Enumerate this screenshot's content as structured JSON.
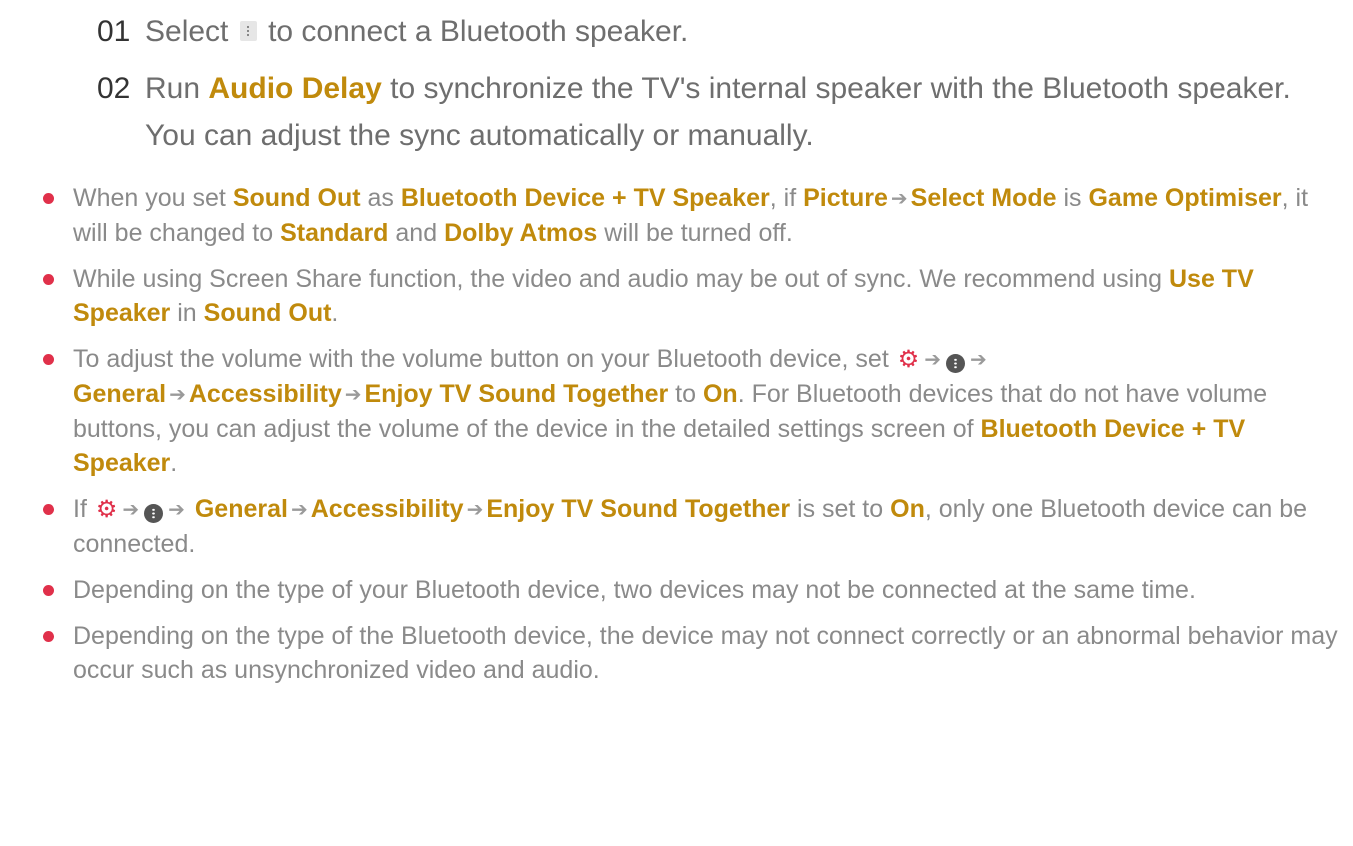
{
  "steps": [
    {
      "num": "01",
      "pre": "Select",
      "post": "to connect a Bluetooth speaker."
    },
    {
      "num": "02",
      "pre": "Run",
      "kw": "Audio Delay",
      "post": "to synchronize the TV's internal speaker with the Bluetooth speaker. You can adjust the sync automatically or manually."
    }
  ],
  "notes": {
    "n1": {
      "t1": "When you set",
      "k1": "Sound Out",
      "t2": "as",
      "k2": "Bluetooth Device + TV Speaker",
      "t3": ", if",
      "k3": "Picture",
      "k4": "Select Mode",
      "t4": "is",
      "k5": "Game Optimiser",
      "t5": ", it will be changed to",
      "k6": "Standard",
      "t6": "and",
      "k7": "Dolby Atmos",
      "t7": "will be turned off."
    },
    "n2": {
      "t1": "While using Screen Share function, the video and audio may be out of sync. We recommend using",
      "k1": "Use TV Speaker",
      "t2": "in",
      "k2": "Sound Out",
      "t3": "."
    },
    "n3": {
      "t1": "To adjust the volume with the volume button on your Bluetooth device, set",
      "k1": "General",
      "k2": "Accessibility",
      "k3": "Enjoy TV Sound Together",
      "t2": "to",
      "k4": "On",
      "t3": ". For Bluetooth devices that do not have volume buttons, you can adjust the volume of the device in the detailed settings screen of",
      "k5": "Bluetooth Device + TV Speaker",
      "t4": "."
    },
    "n4": {
      "t1": "If",
      "k1": "General",
      "k2": "Accessibility",
      "k3": "Enjoy TV Sound Together",
      "t2": "is set to",
      "k4": "On",
      "t3": ", only one Bluetooth device can be connected."
    },
    "n5": {
      "text": "Depending on the type of your Bluetooth device, two devices may not be connected at the same time."
    },
    "n6": {
      "text": "Depending on the type of the Bluetooth device, the device may not connect correctly or an abnormal behavior may occur such as unsynchronized video and audio."
    }
  },
  "glyphs": {
    "arrow": "➔",
    "gear": "⚙"
  },
  "icons": {
    "step_menu": "vertical-dots-icon",
    "settings": "gear-icon",
    "more": "more-options-icon"
  },
  "colors": {
    "keyword": "#c08a0c",
    "bullet": "#e0304a",
    "body_text": "#8a8a8a",
    "step_number": "#333333"
  }
}
